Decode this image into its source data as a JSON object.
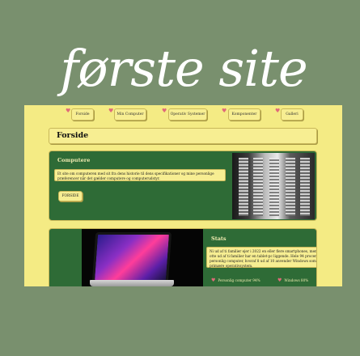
{
  "brand": {
    "logo_text": "første site"
  },
  "nav": {
    "items": [
      {
        "label": "Forside"
      },
      {
        "label": "Min Computer"
      },
      {
        "label": "Operativ Systemer"
      },
      {
        "label": "Komponenter"
      },
      {
        "label": "Galleri"
      }
    ]
  },
  "page": {
    "title": "Forside"
  },
  "computere": {
    "heading": "Computere",
    "description": "Et site om computeren med sit fra dens historie til dens specifikationer og mine personlige præferencer når det gælder computere og computerudstyr.",
    "button_label": "FORSIDE"
  },
  "stats": {
    "heading": "Stats",
    "description": "Ni ud af ti familier ejer i 2022 en eller flere smartphones, mens knap otte ud af ti familier har en tablet-pc liggende. Hele 94 procent ejer en personlig computer, hvoraf 8 ud af 10 anvender Windows som deres primære operativsystem.",
    "items": [
      {
        "label": "Personlig computer 94%"
      },
      {
        "label": "Windows 80%"
      }
    ]
  },
  "colors": {
    "background": "#79906e",
    "panel": "#f4eb84",
    "card": "#2e6b36",
    "accent": "#e06a7a"
  },
  "icons": {
    "nav_marker": "heart-icon",
    "stat_marker": "heart-icon"
  }
}
